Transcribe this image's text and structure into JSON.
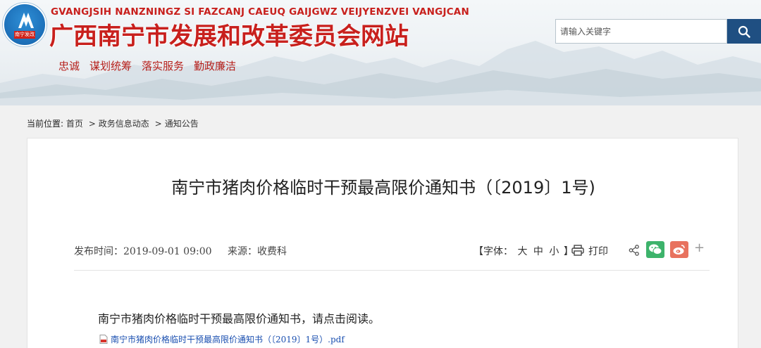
{
  "header": {
    "logo_badge": "南宁发改",
    "pinyin": "GVANGJSIH NANZNINGZ SI FAZCANJ CAEUQ GAIJGWZ VEIJYENZVEI VANGJCAN",
    "site_title": "广西南宁市发展和改革委员会网站",
    "nav": [
      "忠诚",
      "谋划统筹",
      "落实服务",
      "勤政廉洁"
    ],
    "search": {
      "placeholder": "请输入关键字"
    }
  },
  "breadcrumb": {
    "label": "当前位置:",
    "items": [
      "首页",
      "政务信息动态",
      "通知公告"
    ],
    "separator": ">"
  },
  "article": {
    "title": "南宁市猪肉价格临时干预最高限价通知书（〔2019〕1号)",
    "publish_time_label": "发布时间：",
    "publish_time": "2019-09-01 09:00",
    "source_label": "来源：",
    "source": "收费科",
    "font_label": "【字体：",
    "font_sizes": [
      "大",
      "中",
      "小"
    ],
    "font_close": "】",
    "print_label": "打印",
    "more_label": "+",
    "body": "南宁市猪肉价格临时干预最高限价通知书，请点击阅读。",
    "attachment": "南宁市猪肉价格临时干预最高限价通知书（〔2019〕1号）.pdf"
  },
  "colors": {
    "brand_red": "#c8201d",
    "search_button": "#1f4f82",
    "wechat": "#3db36b",
    "weibo": "#e8725e",
    "link_blue": "#1a4fb0"
  }
}
